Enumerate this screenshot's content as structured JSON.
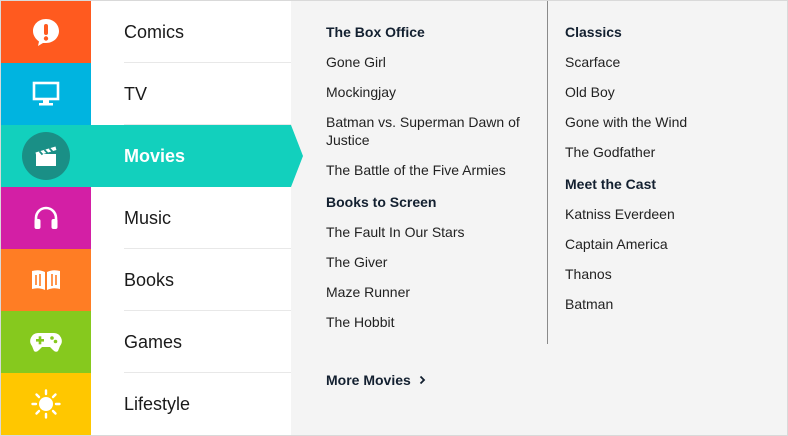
{
  "categories": [
    {
      "label": "Comics",
      "icon": "exclamation-bubble-icon",
      "color": "#ff5a1f"
    },
    {
      "label": "TV",
      "icon": "monitor-icon",
      "color": "#00b4e0"
    },
    {
      "label": "Movies",
      "icon": "clapperboard-icon",
      "color": "#12d0bd",
      "active": true
    },
    {
      "label": "Music",
      "icon": "headphones-icon",
      "color": "#d31fa5"
    },
    {
      "label": "Books",
      "icon": "open-book-icon",
      "color": "#ff7d24"
    },
    {
      "label": "Games",
      "icon": "gamepad-icon",
      "color": "#86c91e"
    },
    {
      "label": "Lifestyle",
      "icon": "sun-icon",
      "color": "#ffc700"
    }
  ],
  "menu": {
    "col1": [
      {
        "title": "The Box Office",
        "links": [
          "Gone Girl",
          "Mockingjay",
          "Batman vs. Superman Dawn of Justice",
          "The Battle of the Five Armies"
        ]
      },
      {
        "title": "Books to Screen",
        "links": [
          "The Fault In Our Stars",
          "The Giver",
          "Maze Runner",
          "The Hobbit"
        ]
      }
    ],
    "col2": [
      {
        "title": "Classics",
        "links": [
          "Scarface",
          "Old Boy",
          "Gone with the Wind",
          "The Godfather"
        ]
      },
      {
        "title": "Meet the Cast",
        "links": [
          "Katniss Everdeen",
          "Captain America",
          "Thanos",
          "Batman"
        ]
      }
    ]
  },
  "more_link": "More Movies"
}
